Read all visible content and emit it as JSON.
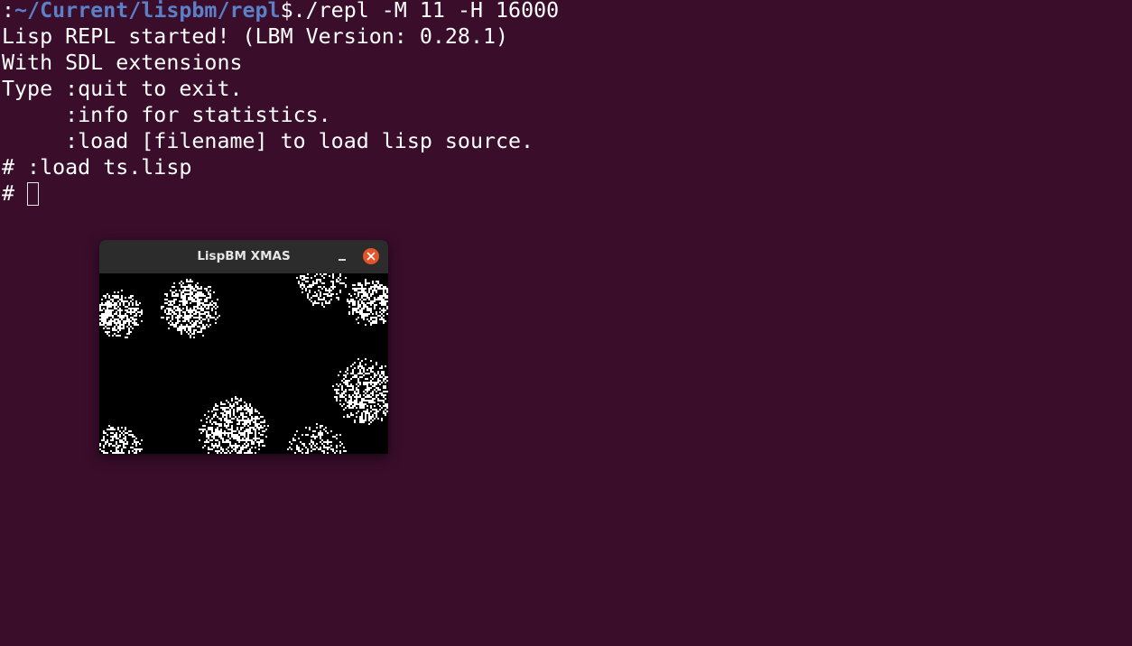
{
  "terminal": {
    "prompt_prefix": ":",
    "prompt_path": "~/Current/lispbm/repl",
    "prompt_command": "$./repl -M 11 -H 16000",
    "lines": [
      "Lisp REPL started! (LBM Version: 0.28.1)",
      "With SDL extensions",
      "Type :quit to exit.",
      "     :info for statistics.",
      "     :load [filename] to load lisp source.",
      "# :load ts.lisp"
    ],
    "current_prompt": "# "
  },
  "sdl_window": {
    "title": "LispBM XMAS",
    "minimize_glyph": "–",
    "close_icon": "close-icon",
    "close_color": "#e2542a"
  },
  "colors": {
    "background": "#3a0d2b",
    "path": "#5c80c8",
    "text": "#ffffff"
  }
}
